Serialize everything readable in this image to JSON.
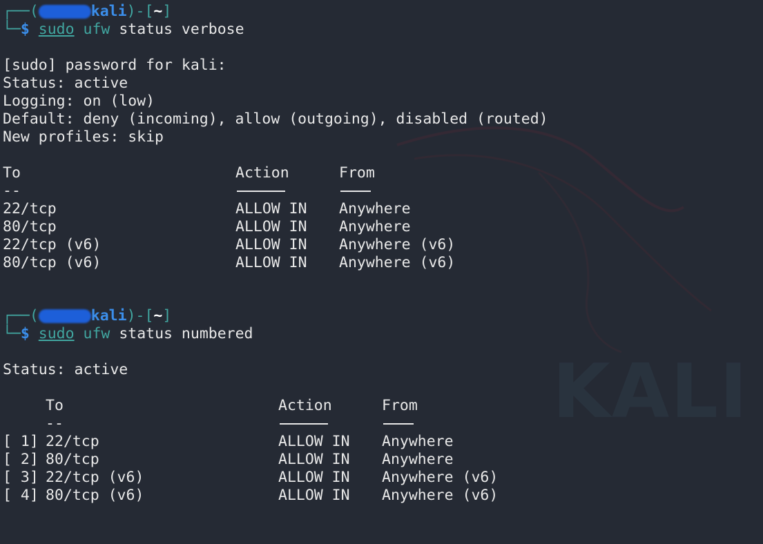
{
  "prompt1": {
    "open": "┌──(",
    "user": "",
    "host": "kali",
    "close_dir_open": ")-[",
    "dir": "~",
    "close_dir": "]",
    "corner": "└─",
    "dollar": "$",
    "sudo": "sudo",
    "ufw": "ufw",
    "args": "status verbose"
  },
  "verbose_output": {
    "password_prompt": "[sudo] password for kali:",
    "status": "Status: active",
    "logging": "Logging: on (low)",
    "default": "Default: deny (incoming), allow (outgoing), disabled (routed)",
    "new_profiles": "New profiles: skip"
  },
  "verbose_table": {
    "headers": {
      "to": "To",
      "action": "Action",
      "from": "From"
    },
    "to_separator": "--",
    "rows": [
      {
        "to": "22/tcp",
        "action": "ALLOW IN",
        "from": "Anywhere"
      },
      {
        "to": "80/tcp",
        "action": "ALLOW IN",
        "from": "Anywhere"
      },
      {
        "to": "22/tcp (v6)",
        "action": "ALLOW IN",
        "from": "Anywhere (v6)"
      },
      {
        "to": "80/tcp (v6)",
        "action": "ALLOW IN",
        "from": "Anywhere (v6)"
      }
    ]
  },
  "prompt2": {
    "open": "┌──(",
    "user": "",
    "host": "kali",
    "close_dir_open": ")-[",
    "dir": "~",
    "close_dir": "]",
    "corner": "└─",
    "dollar": "$",
    "sudo": "sudo",
    "ufw": "ufw",
    "args": "status numbered"
  },
  "numbered_output": {
    "status": "Status: active"
  },
  "numbered_table": {
    "headers": {
      "to": "To",
      "action": "Action",
      "from": "From"
    },
    "to_separator": "--",
    "rows": [
      {
        "num": "[ 1]",
        "to": "22/tcp",
        "action": "ALLOW IN",
        "from": "Anywhere"
      },
      {
        "num": "[ 2]",
        "to": "80/tcp",
        "action": "ALLOW IN",
        "from": "Anywhere"
      },
      {
        "num": "[ 3]",
        "to": "22/tcp (v6)",
        "action": "ALLOW IN",
        "from": "Anywhere (v6)"
      },
      {
        "num": "[ 4]",
        "to": "80/tcp (v6)",
        "action": "ALLOW IN",
        "from": "Anywhere (v6)"
      }
    ]
  },
  "watermark": {
    "text": "KALI"
  },
  "colors": {
    "background": "#252a34",
    "prompt": "#41a6a0",
    "host": "#3b8eea",
    "text": "#e8e8e8"
  }
}
